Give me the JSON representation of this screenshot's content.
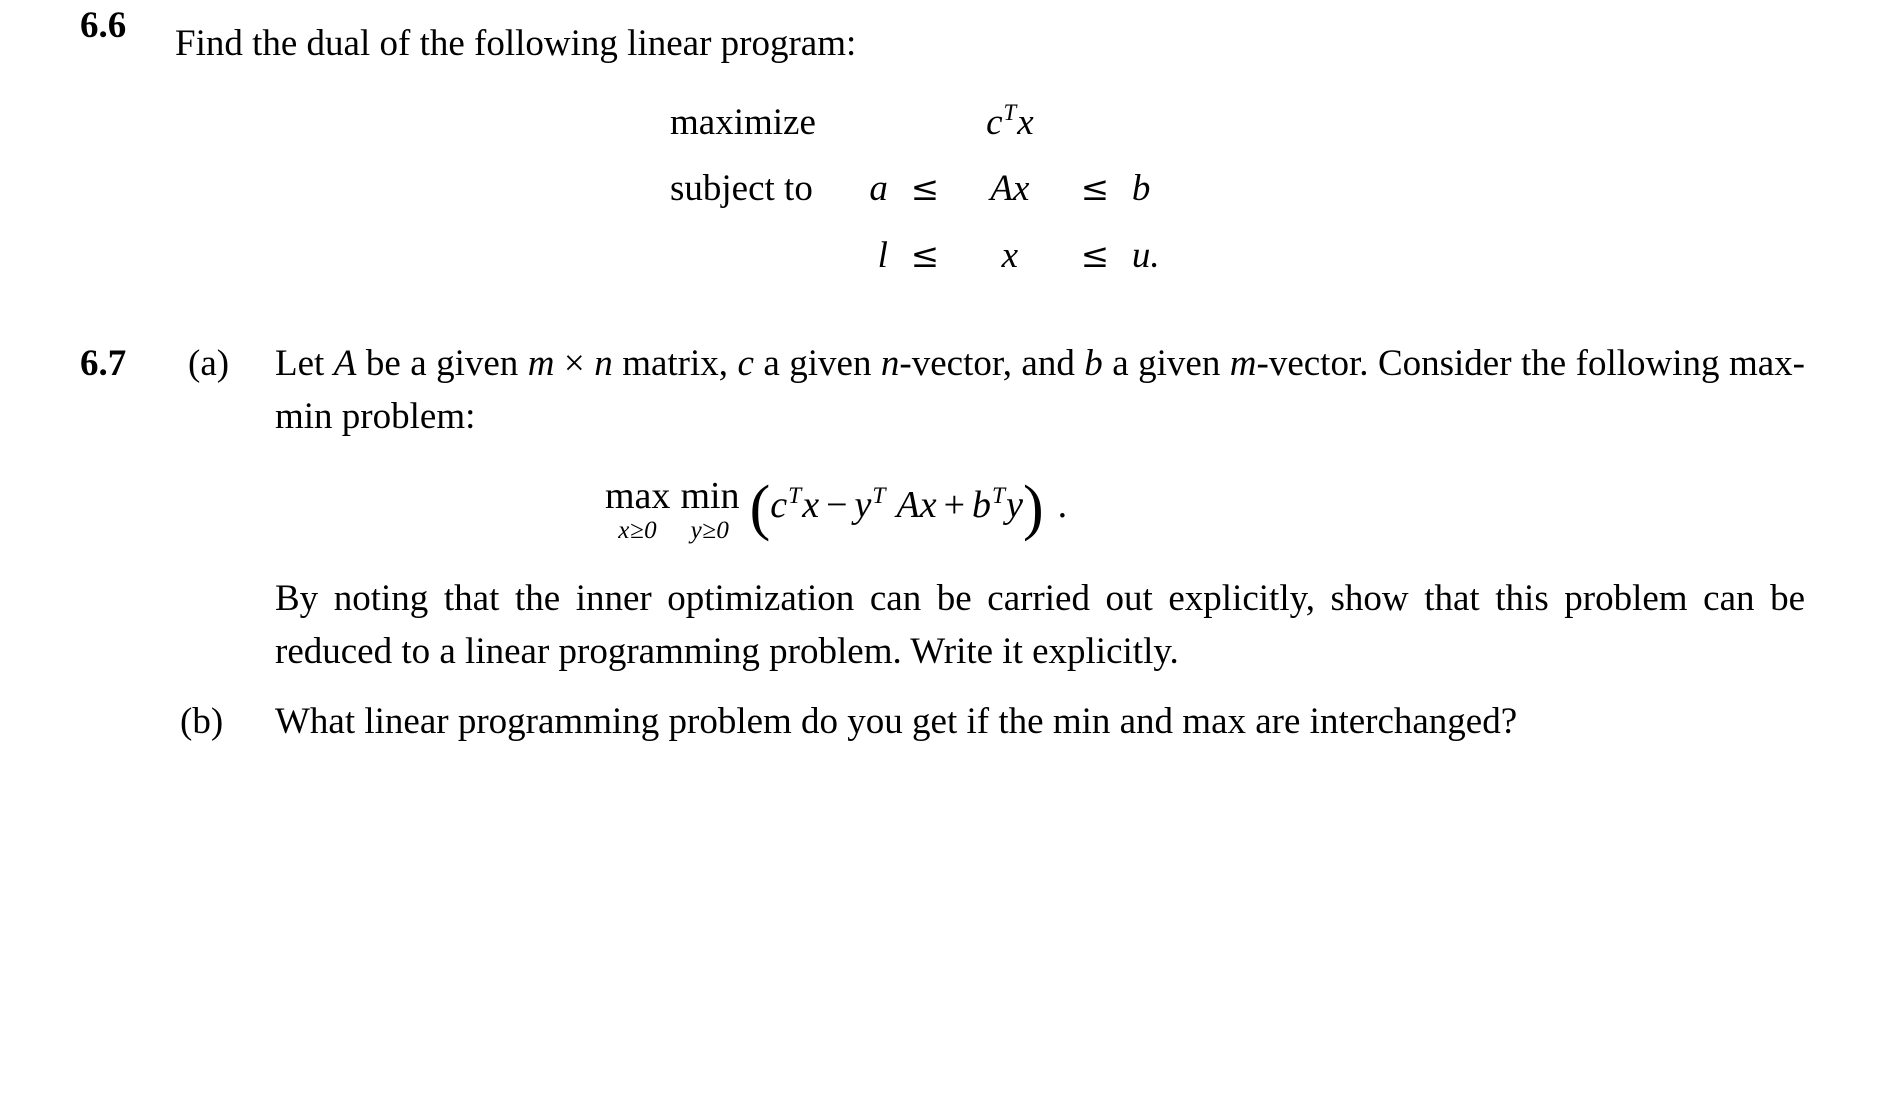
{
  "document": {
    "type": "textbook-exercise-page",
    "background_color": "#ffffff",
    "text_color": "#000000"
  },
  "exercises": [
    {
      "number": "6.6",
      "lead": "Find the dual of the following linear program:",
      "display": {
        "kind": "linear-program",
        "rows": [
          {
            "label": "maximize",
            "lhs": "",
            "rel1": "",
            "mid": "c",
            "mid_sup": "T",
            "mid_var": "x",
            "rel2": "",
            "rhs": ""
          },
          {
            "label": "subject to",
            "lhs": "a",
            "rel1": "≤",
            "mid": "Ax",
            "rel2": "≤",
            "rhs": "b"
          },
          {
            "label": "",
            "lhs": "l",
            "rel1": "≤",
            "mid": "x",
            "rel2": "≤",
            "rhs": "u."
          }
        ]
      }
    },
    {
      "number": "6.7",
      "parts": [
        {
          "tag": "(a)",
          "text_lines": [
            "Let A be a given m × n matrix, c a given n-vector, and b a given m-vector. Consider the following max-min problem:"
          ],
          "display": {
            "kind": "max-min",
            "outer_op": "max",
            "outer_limit": "x≥0",
            "inner_op": "min",
            "inner_limit": "y≥0",
            "body": "cᵀx − yᵀAx + bᵀy",
            "terms": [
              {
                "base": "c",
                "sup": "T",
                "var": "x"
              },
              {
                "op": "−",
                "base": "y",
                "sup": "T",
                "var": "Ax"
              },
              {
                "op": "+",
                "base": "b",
                "sup": "T",
                "var": "y"
              }
            ],
            "trailing_punctuation": "."
          },
          "paragraph": "By noting that the inner optimization can be carried out explicitly, show that this problem can be reduced to a linear programming problem. Write it explicitly."
        },
        {
          "tag": "(b)",
          "paragraph": "What linear programming problem do you get if the min and max are interchanged?"
        }
      ]
    }
  ],
  "symbols": {
    "leq": "≤",
    "geq": "≥",
    "times": "×",
    "minus": "−",
    "plus": "+",
    "transpose": "T",
    "lparen": "(",
    "rparen": ")",
    "period": "."
  },
  "math_tokens": {
    "maximize": "maximize",
    "subject_to": "subject to",
    "c": "c",
    "x": "x",
    "a": "a",
    "A": "A",
    "Ax": "Ax",
    "b": "b",
    "l": "l",
    "u_period": "u.",
    "max": "max",
    "min": "min",
    "x_ge_0": "x≥0",
    "y_ge_0": "y≥0",
    "y": "y"
  },
  "inline_67a": {
    "t1": "Let ",
    "A": "A",
    "t2": " be a given ",
    "m": "m",
    "times": " × ",
    "n": "n",
    "t3": " matrix, ",
    "c": "c",
    "t4": " a given ",
    "n2": "n",
    "t5": "-vector, and ",
    "b": "b",
    "t6": " a given ",
    "m2": "m",
    "t7": "-vector. Consider the following max-min problem:"
  }
}
